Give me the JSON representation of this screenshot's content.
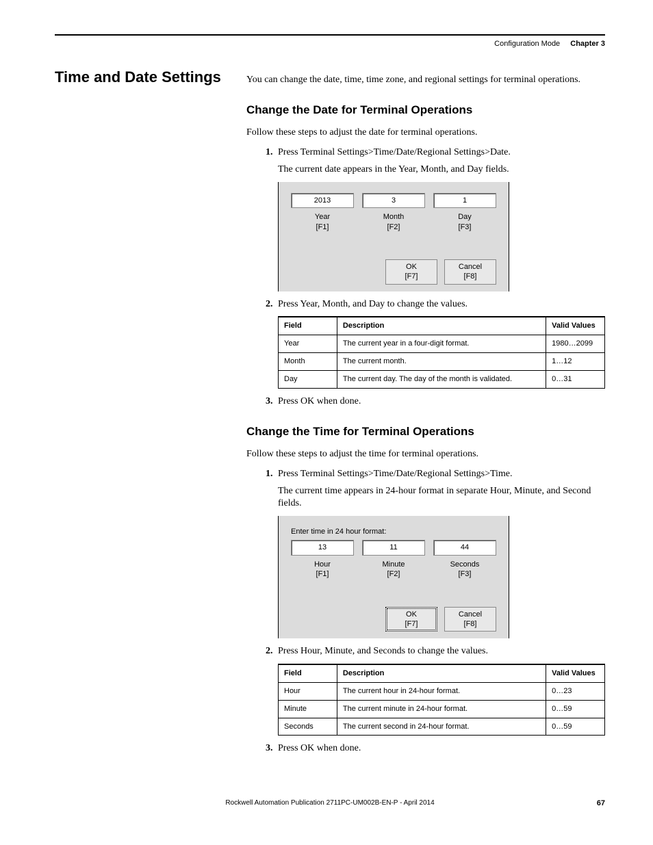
{
  "header": {
    "section": "Configuration Mode",
    "chapter": "Chapter 3"
  },
  "left_title": "Time and Date Settings",
  "intro": "You can change the date, time, time zone, and regional settings for terminal operations.",
  "date_section": {
    "heading": "Change the Date for Terminal Operations",
    "lead": "Follow these steps to adjust the date for terminal operations.",
    "step1": "Press Terminal Settings>Time/Date/Regional Settings>Date.",
    "step1_sub": "The current date appears in the Year, Month, and Day fields.",
    "dialog": {
      "year_val": "2013",
      "month_val": "3",
      "day_val": "1",
      "year_label": "Year",
      "year_key": "[F1]",
      "month_label": "Month",
      "month_key": "[F2]",
      "day_label": "Day",
      "day_key": "[F3]",
      "ok_label": "OK",
      "ok_key": "[F7]",
      "cancel_label": "Cancel",
      "cancel_key": "[F8]"
    },
    "step2": "Press Year, Month, and Day to change the values.",
    "table": {
      "head_field": "Field",
      "head_desc": "Description",
      "head_valid": "Valid Values",
      "rows": [
        {
          "field": "Year",
          "desc": "The current year in a four-digit format.",
          "valid": "1980…2099"
        },
        {
          "field": "Month",
          "desc": "The current month.",
          "valid": "1…12"
        },
        {
          "field": "Day",
          "desc": "The current day. The day of the month is validated.",
          "valid": "0…31"
        }
      ]
    },
    "step3": "Press OK when done."
  },
  "time_section": {
    "heading": "Change the Time for Terminal Operations",
    "lead": "Follow these steps to adjust the time for terminal operations.",
    "step1": "Press Terminal Settings>Time/Date/Regional Settings>Time.",
    "step1_sub": "The current time appears in 24-hour format in separate Hour, Minute, and Second fields.",
    "dialog": {
      "caption": "Enter time in 24 hour format:",
      "hour_val": "13",
      "minute_val": "11",
      "seconds_val": "44",
      "hour_label": "Hour",
      "hour_key": "[F1]",
      "minute_label": "Minute",
      "minute_key": "[F2]",
      "seconds_label": "Seconds",
      "seconds_key": "[F3]",
      "ok_label": "OK",
      "ok_key": "[F7]",
      "cancel_label": "Cancel",
      "cancel_key": "[F8]"
    },
    "step2": "Press Hour, Minute, and Seconds to change the values.",
    "table": {
      "head_field": "Field",
      "head_desc": "Description",
      "head_valid": "Valid Values",
      "rows": [
        {
          "field": "Hour",
          "desc": "The current hour in 24-hour format.",
          "valid": "0…23"
        },
        {
          "field": "Minute",
          "desc": "The current minute in 24-hour format.",
          "valid": "0…59"
        },
        {
          "field": "Seconds",
          "desc": "The current second in 24-hour format.",
          "valid": "0…59"
        }
      ]
    },
    "step3": "Press OK when done."
  },
  "footer": {
    "publication": "Rockwell Automation Publication 2711PC-UM002B-EN-P - April 2014",
    "page": "67"
  }
}
